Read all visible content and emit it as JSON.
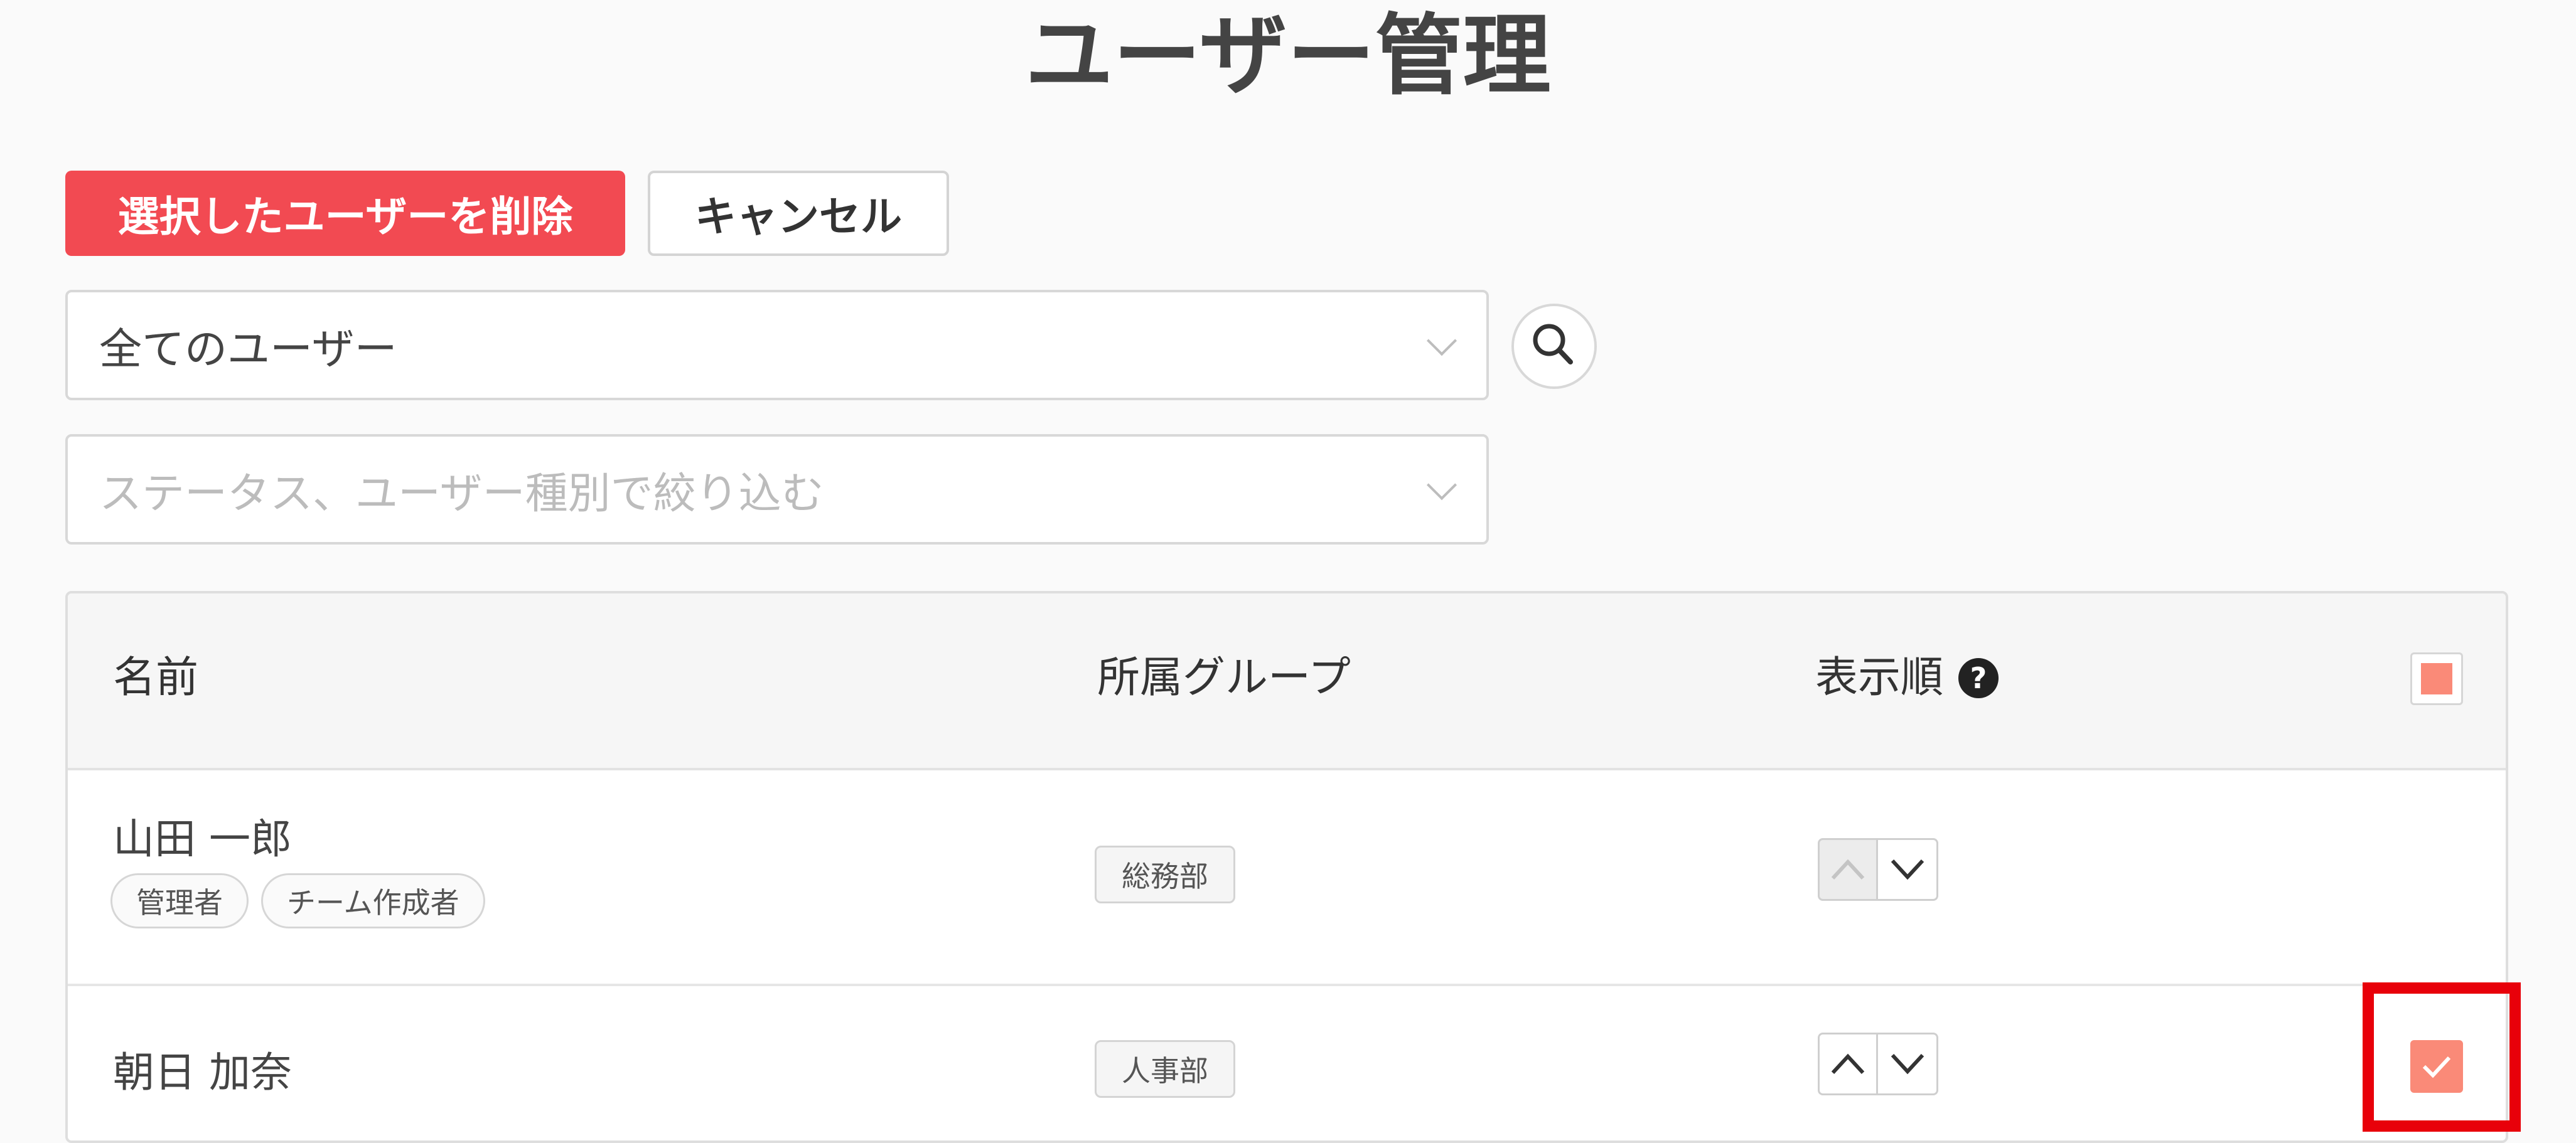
{
  "page": {
    "title": "ユーザー管理"
  },
  "actions": {
    "delete_label": "選択したユーザーを削除",
    "cancel_label": "キャンセル"
  },
  "filters": {
    "user_select_value": "全てのユーザー",
    "status_placeholder": "ステータス、ユーザー種別で絞り込む"
  },
  "table": {
    "headers": {
      "name": "名前",
      "group": "所属グループ",
      "order": "表示順",
      "help": "?"
    },
    "rows": [
      {
        "name": "山田 一郎",
        "tags": [
          "管理者",
          "チーム作成者"
        ],
        "group": "総務部",
        "up_enabled": false,
        "down_enabled": true,
        "selected": false
      },
      {
        "name": "朝日 加奈",
        "tags": [],
        "group": "人事部",
        "up_enabled": true,
        "down_enabled": true,
        "selected": true
      }
    ]
  },
  "colors": {
    "danger": "#f24a52",
    "check_accent": "#fa8a78",
    "highlight": "#e8000a"
  },
  "icons": {
    "search": "search-icon",
    "help": "question-circle-icon",
    "chevron": "chevron-down-icon"
  }
}
